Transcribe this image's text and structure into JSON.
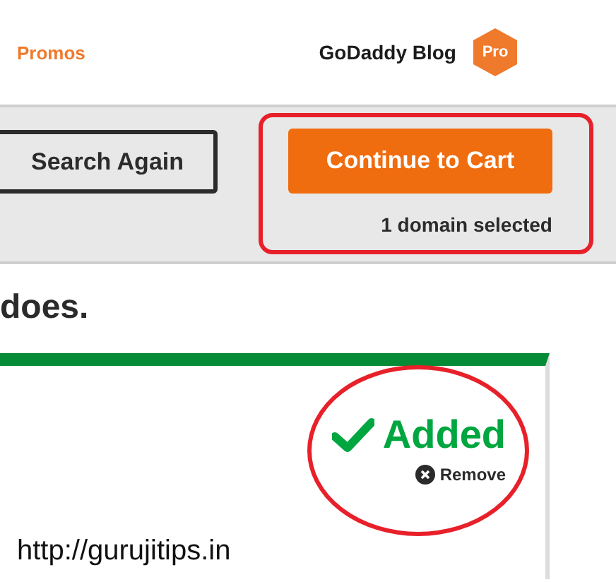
{
  "nav": {
    "promos": "Promos",
    "blog": "GoDaddy Blog",
    "badge": "Pro"
  },
  "toolbar": {
    "search_again": "Search Again",
    "continue": "Continue to Cart",
    "selection": "1 domain selected"
  },
  "heading": "does.",
  "result": {
    "status": "Added",
    "remove": "Remove",
    "domain": "http://gurujitips.in"
  }
}
